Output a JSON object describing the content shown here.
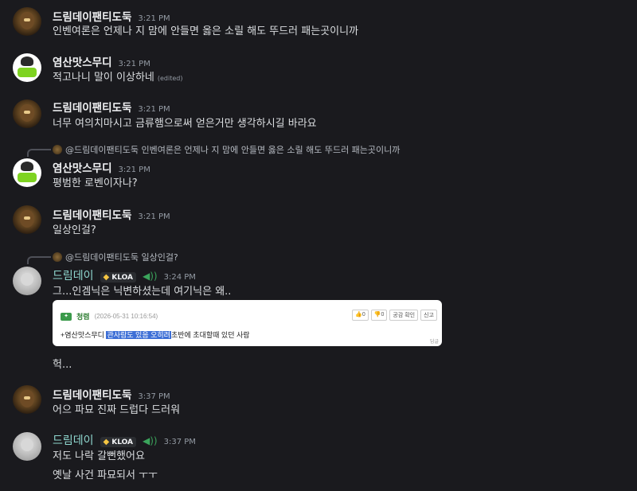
{
  "messages": [
    {
      "author": "드림데이팬티도둑",
      "time": "3:21 PM",
      "lines": [
        "인벤여론은 언제나 지 맘에 안들면 옳은 소릴 해도 뚜드러 패는곳이니까"
      ]
    },
    {
      "author": "염산맛스무디",
      "time": "3:21 PM",
      "lines": [
        "적고나니 말이 이상하네"
      ],
      "edited": "(edited)"
    },
    {
      "author": "드림데이팬티도둑",
      "time": "3:21 PM",
      "lines": [
        "너무 여의치마시고 금류햄으로써 얻은거만 생각하시길 바라요"
      ]
    },
    {
      "reply": "@드림데이팬티도둑 인벤여론은 언제나 지 맘에 안들면 옳은 소릴 해도 뚜드러 패는곳이니까",
      "author": "염산맛스무디",
      "time": "3:21 PM",
      "lines": [
        "평범한 로벤이자나?"
      ]
    },
    {
      "author": "드림데이팬티도둑",
      "time": "3:21 PM",
      "lines": [
        "일상인걸?"
      ]
    },
    {
      "reply": "@드림데이팬티도둑 일상인걸?",
      "author": "드림데이",
      "badge": "KLOA",
      "time": "3:24 PM",
      "lines": [
        "그...인겜닉은 닉변하셨는데 여기닉은 왜..",
        "헉..."
      ]
    },
    {
      "author": "드림데이팬티도둑",
      "time": "3:37 PM",
      "lines": [
        "어으 파묘 진짜 드럽다 드러워"
      ]
    },
    {
      "author": "드림데이",
      "badge": "KLOA",
      "time": "3:37 PM",
      "lines": [
        "저도 나락 갈뻔했어요",
        "옛날 사건 파묘되서 ㅜㅜ"
      ]
    }
  ],
  "embed": {
    "name": "청렴",
    "date": "(2026-05-31 10:16:54)",
    "buttons": [
      "👍0",
      "👎0",
      "공감 확인",
      "신고"
    ],
    "body_prefix": "+염산맛스무디 ",
    "body_highlight": "관사람도 있음 오히려",
    "body_suffix": "초반에 초대할때 있던 사람",
    "footer": "답글"
  },
  "colors": {
    "background": "#1a1a1e",
    "text": "#dbdee1",
    "timestamp": "#949ba4",
    "teal_name": "#8fd7cf",
    "highlight": "#3d6fd6"
  }
}
